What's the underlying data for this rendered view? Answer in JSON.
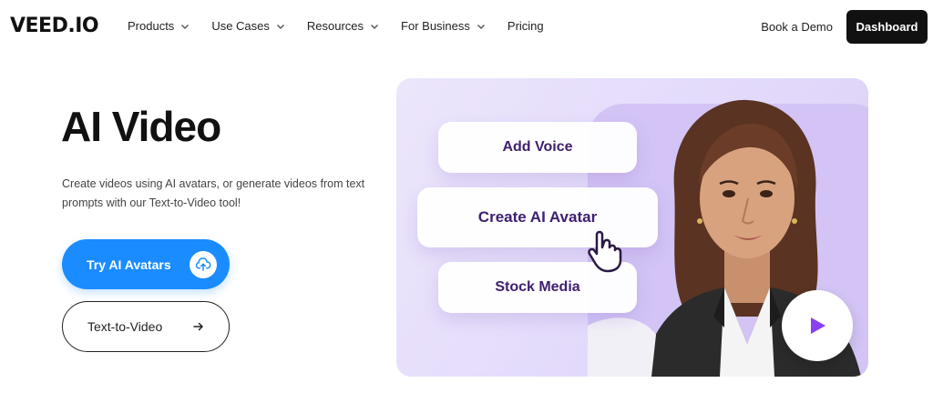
{
  "nav": {
    "logo": "VEED.IO",
    "menu": [
      {
        "label": "Products",
        "has_dropdown": true
      },
      {
        "label": "Use Cases",
        "has_dropdown": true
      },
      {
        "label": "Resources",
        "has_dropdown": true
      },
      {
        "label": "For Business",
        "has_dropdown": true
      },
      {
        "label": "Pricing",
        "has_dropdown": false
      }
    ],
    "book_demo": "Book a Demo",
    "dashboard": "Dashboard"
  },
  "hero": {
    "title": "AI Video",
    "description": "Create videos using AI avatars, or generate videos from text prompts with our Text-to-Video tool!",
    "primary_button": "Try AI Avatars",
    "primary_button_icon": "upload-cloud-icon",
    "secondary_button": "Text-to-Video",
    "secondary_button_icon": "arrow-right-icon"
  },
  "media": {
    "chips": [
      "Add Voice",
      "Create AI Avatar",
      "Stock Media"
    ],
    "cursor_icon": "hand-pointer-icon",
    "play_icon": "play-icon"
  },
  "colors": {
    "primary": "#1a8cff",
    "dark": "#111111",
    "card_bg": "#e6dffb",
    "chip_text": "#3d1f6e",
    "play": "#8a3ff0"
  }
}
